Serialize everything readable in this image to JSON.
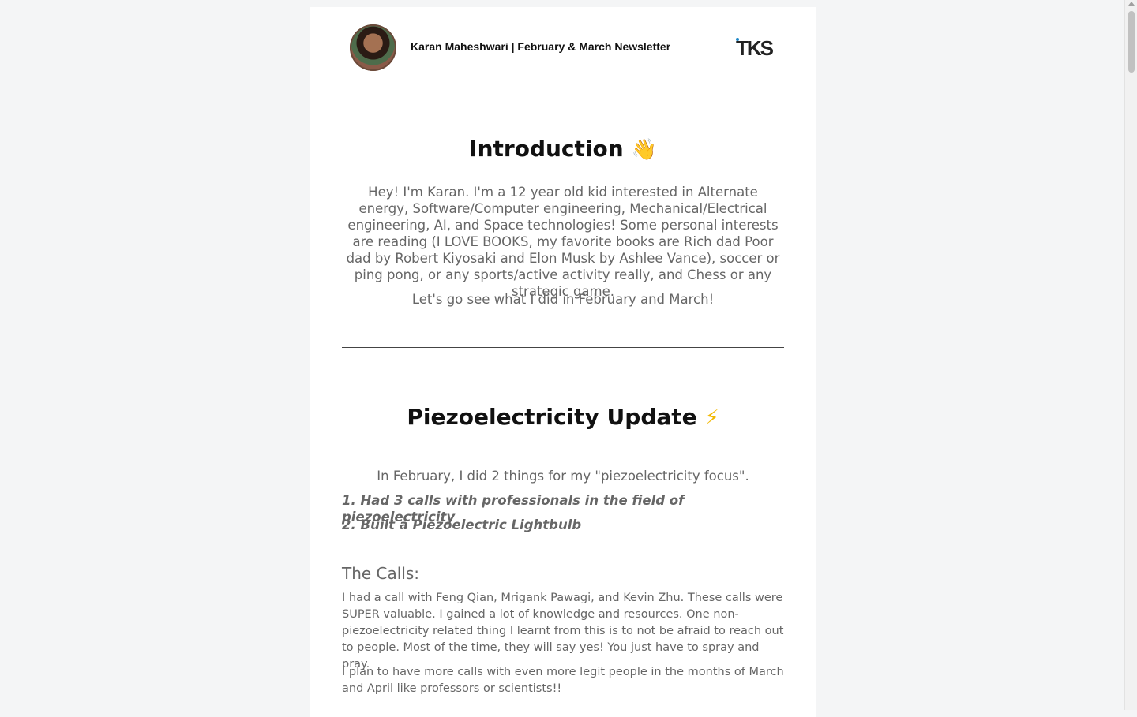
{
  "header": {
    "title": "Karan Maheshwari | February & March Newsletter",
    "logo_text": "TKS",
    "avatar_icon": "profile-photo"
  },
  "intro": {
    "heading": "Introduction",
    "heading_emoji": "👋",
    "paragraph": "Hey! I'm Karan. I'm a 12 year old kid interested in Alternate energy, Software/Computer engineering, Mechanical/Electrical engineering, AI, and Space technologies! Some personal interests are reading (I LOVE BOOKS, my favorite books are Rich dad Poor dad by Robert Kiyosaki and Elon Musk by Ashlee Vance), soccer or ping pong, or any sports/active activity really, and Chess or any strategic game.",
    "closing": "Let's go see what I did in February and March!"
  },
  "piezo": {
    "heading": "Piezoelectricity Update",
    "heading_emoji": "⚡",
    "summary": "In February, I did 2 things for my \"piezoelectricity focus\".",
    "item1": "1. Had 3 calls with professionals in the field of piezoelectricity",
    "item2": "2. Built a Piezoelectric Lightbulb",
    "calls_heading": "The Calls:",
    "calls_p1": "I had a call with Feng Qian, Mrigank Pawagi, and Kevin Zhu. These calls were SUPER valuable. I gained a lot of knowledge and resources. One non-piezoelectricity related thing I learnt from this is to not be afraid to reach out to people. Most of the time, they will say yes! You just have to spray and pray.",
    "calls_p2": "I plan to have more calls with even more legit people in the months of March and April like professors or scientists!!"
  },
  "colors": {
    "background": "#f4f5f6",
    "card": "#ffffff",
    "text_muted": "#666666",
    "heading": "#111111",
    "logo_accent": "#1e88c8"
  }
}
